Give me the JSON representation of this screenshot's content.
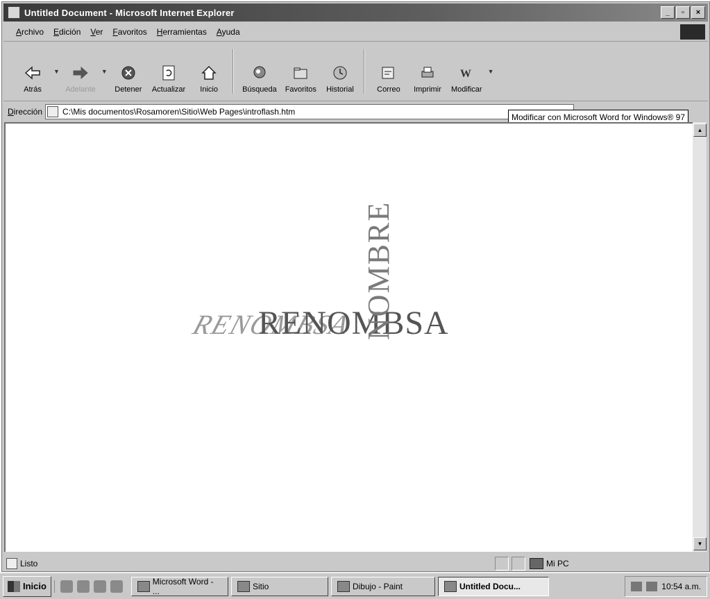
{
  "window": {
    "title": "Untitled Document - Microsoft Internet Explorer",
    "controls": [
      "_",
      "▫",
      "×"
    ]
  },
  "menu": [
    "Archivo",
    "Edición",
    "Ver",
    "Favoritos",
    "Herramientas",
    "Ayuda"
  ],
  "toolbar": {
    "back": "Atrás",
    "forward": "Adelante",
    "stop": "Detener",
    "refresh": "Actualizar",
    "home": "Inicio",
    "search": "Búsqueda",
    "favorites": "Favoritos",
    "history": "Historial",
    "mail": "Correo",
    "print": "Imprimir",
    "edit": "Modificar"
  },
  "address": {
    "label": "Dirección",
    "value": "C:\\Mis documentos\\Rosamoren\\Sitio\\Web Pages\\introflash.htm"
  },
  "tooltip": "Modificar con Microsoft Word for Windows® 97",
  "content": {
    "logo_main": "RENOMBSA",
    "logo_ghost": "RENOMBSA",
    "logo_vertical": "NOMBRE"
  },
  "status": {
    "text": "Listo",
    "zone": "Mi PC"
  },
  "taskbar": {
    "start": "Inicio",
    "tasks": [
      {
        "label": "Microsoft Word - ..."
      },
      {
        "label": "Sitio"
      },
      {
        "label": "Dibujo - Paint"
      },
      {
        "label": "Untitled Docu..."
      }
    ],
    "clock": "10:54 a.m."
  }
}
